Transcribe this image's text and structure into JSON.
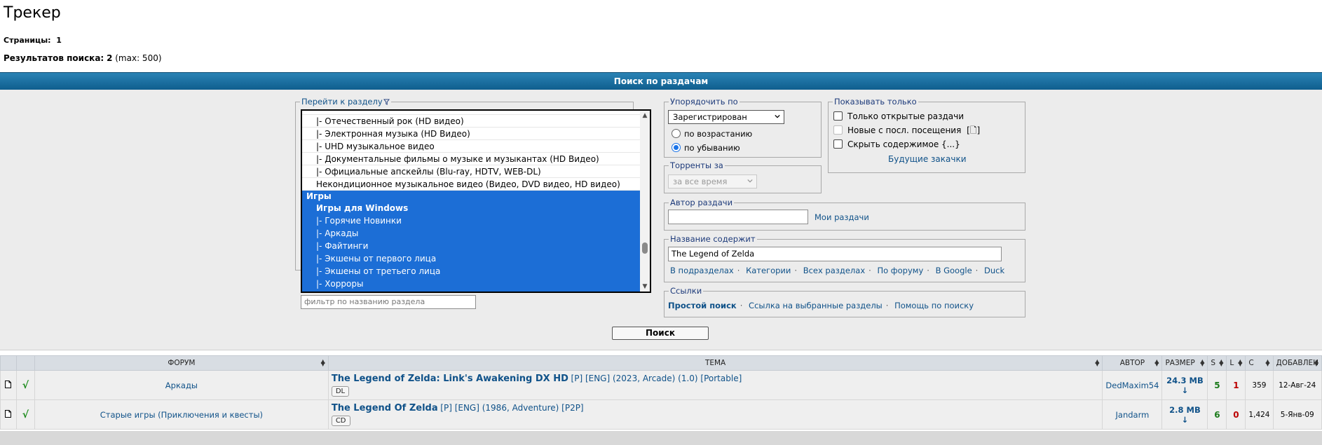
{
  "page": {
    "title": "Трекер",
    "pages_label": "Страницы:",
    "pages_value": "1",
    "results_label": "Результатов поиска:",
    "results_count": "2",
    "results_max": "(max: 500)"
  },
  "search_panel": {
    "header": "Поиск по раздачам",
    "forum_legend": "Перейти к разделу",
    "forum_items": [
      "|- Отечественный рок (HD видео)",
      "|- Электронная музыка (HD Видео)",
      "|- UHD музыкальное видео",
      "|- Документальные фильмы о музыке и музыкантах (HD Видео)",
      "|- Официальные апскейлы (Blu-ray, HDTV, WEB-DL)",
      "Некондиционное музыкальное видео (Видео, DVD видео, HD видео)",
      "Игры",
      "Игры для Windows",
      "|- Горячие Новинки",
      "|- Аркады",
      "|- Файтинги",
      "|- Экшены от первого лица",
      "|- Экшены от третьего лица",
      "|- Хорроры"
    ],
    "forum_filter_placeholder": "фильтр по названию раздела",
    "sort_legend": "Упорядочить по",
    "sort_value": "Зарегистрирован",
    "order_asc": "по возрастанию",
    "order_desc": "по убыванию",
    "period_legend": "Торренты за",
    "period_value": "за все время",
    "show_legend": "Показывать только",
    "show_open": "Только открытые раздачи",
    "show_new": "Новые с посл. посещения",
    "show_new_icon": "[🗋]",
    "show_hide": "Скрыть содержимое {...}",
    "future_downloads": "Будущие закачки",
    "author_legend": "Автор раздачи",
    "author_value": "",
    "my_releases": "Мои раздачи",
    "title_legend": "Название содержит",
    "title_value": "The Legend of Zelda",
    "title_links": [
      "В подразделах",
      "Категории",
      "Всех разделах",
      "По форуму",
      "В Google",
      "Duck"
    ],
    "links_legend": "Ссылки",
    "simple_search": "Простой поиск",
    "link_selected": "Ссылка на выбранные разделы",
    "search_help": "Помощь по поиску",
    "search_button": "Поиск"
  },
  "table": {
    "headers": {
      "forum": "ФОРУМ",
      "topic": "ТЕМА",
      "author": "АВТОР",
      "size": "РАЗМЕР",
      "s": "S",
      "l": "L",
      "c": "C",
      "added": "ДОБАВЛЕН"
    },
    "rows": [
      {
        "status": "√",
        "forum": "Аркады",
        "title": "The Legend of Zelda: Link's Awakening DX HD",
        "tags": "[P] [ENG] (2023, Arcade) (1.0) [Portable]",
        "badge": "DL",
        "author": "DedMaxim54",
        "size": "24.3 MB ↓",
        "seeds": "5",
        "leechers": "1",
        "completed": "359",
        "added": "12-Авг-24"
      },
      {
        "status": "√",
        "forum": "Старые игры (Приключения и квесты)",
        "title": "The Legend Of Zelda",
        "tags": "[P] [ENG] (1986, Adventure) [P2P]",
        "badge": "CD",
        "author": "Jandarm",
        "size": "2.8 MB ↓",
        "seeds": "6",
        "leechers": "0",
        "completed": "1,424",
        "added": "5-Янв-09"
      }
    ]
  }
}
